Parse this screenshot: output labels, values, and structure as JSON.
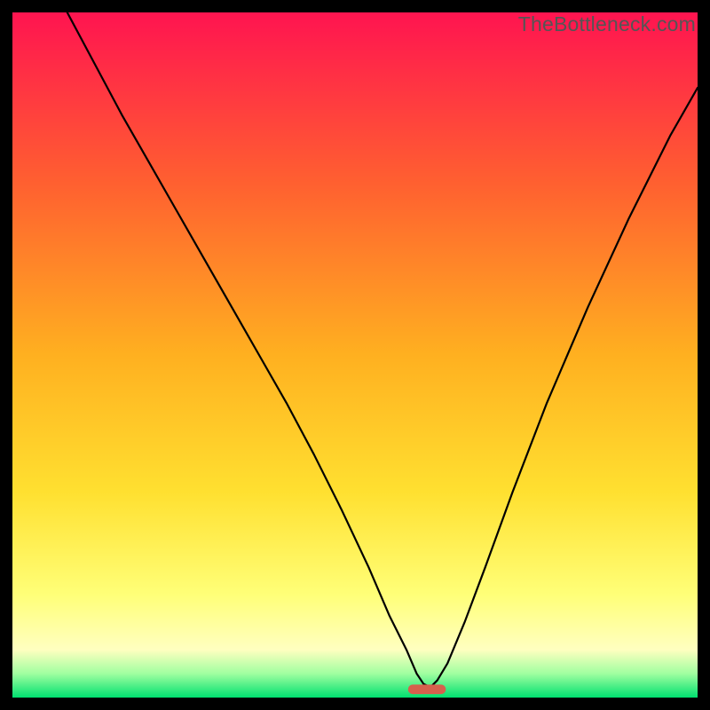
{
  "watermark": "TheBottleneck.com",
  "chart_data": {
    "type": "line",
    "title": "",
    "xlabel": "",
    "ylabel": "",
    "xlim": [
      0,
      100
    ],
    "ylim": [
      0,
      100
    ],
    "grid": false,
    "legend": false,
    "background_gradient": {
      "stops": [
        {
          "offset": 0.0,
          "color": "#ff1450"
        },
        {
          "offset": 0.25,
          "color": "#ff6030"
        },
        {
          "offset": 0.5,
          "color": "#ffb020"
        },
        {
          "offset": 0.7,
          "color": "#ffe030"
        },
        {
          "offset": 0.85,
          "color": "#ffff78"
        },
        {
          "offset": 0.93,
          "color": "#ffffc0"
        },
        {
          "offset": 0.965,
          "color": "#a0ffa0"
        },
        {
          "offset": 1.0,
          "color": "#00e070"
        }
      ]
    },
    "series": [
      {
        "name": "bottleneck-curve",
        "color": "#000000",
        "width": 2.2,
        "x": [
          8,
          12,
          16,
          20,
          24,
          28,
          32,
          36,
          40,
          44,
          48,
          52,
          55,
          57.5,
          59,
          60,
          61,
          62,
          63.5,
          66,
          69,
          73,
          78,
          84,
          90,
          96,
          100
        ],
        "y": [
          100,
          92.5,
          85,
          78,
          71,
          64,
          57,
          50,
          43,
          35.5,
          27.5,
          19,
          12,
          7,
          3.5,
          2,
          1.5,
          2.5,
          5,
          11,
          19,
          30,
          43,
          57,
          70,
          82,
          89
        ]
      }
    ],
    "marker": {
      "x": 60.5,
      "y": 1.2,
      "width": 5.5,
      "height": 1.4,
      "rx": 0.7,
      "color": "#d6604d"
    }
  }
}
